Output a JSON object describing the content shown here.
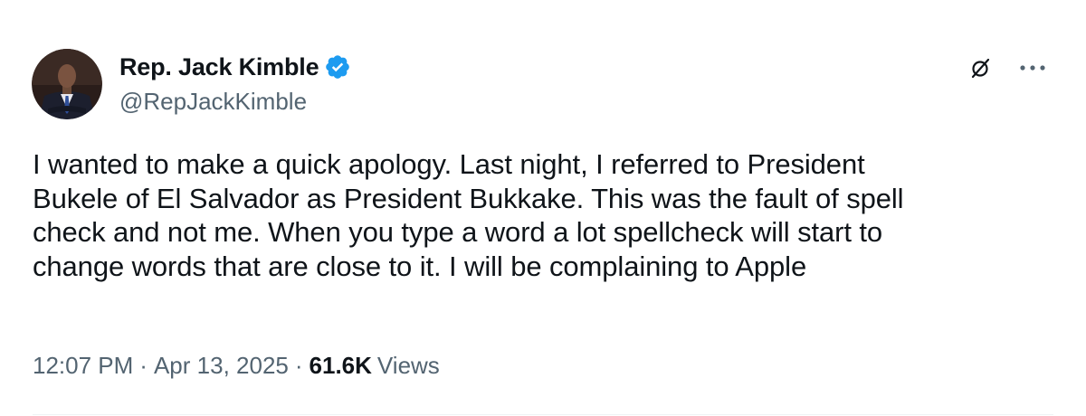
{
  "author": {
    "display_name": "Rep. Jack Kimble",
    "handle": "@RepJackKimble",
    "verified": true
  },
  "tweet": {
    "lines": [
      "I wanted to make a quick apology. Last night, I referred to President",
      "Bukele of El Salvador as President Bukkake. This was the fault of spell",
      "check and not me. When you type a word a lot spellcheck will start to",
      "change words that are close to it. I will be complaining to Apple"
    ]
  },
  "meta": {
    "time": "12:07 PM",
    "separator": "·",
    "date": "Apr 13, 2025",
    "views_count": "61.6K",
    "views_label": "Views"
  },
  "icons": {
    "verified": "verified-badge-icon",
    "grok": "grok-icon",
    "more": "more-options-icon"
  },
  "colors": {
    "text_primary": "#0f1419",
    "text_secondary": "#536471",
    "verified_blue": "#1d9bf0",
    "background": "#ffffff"
  }
}
